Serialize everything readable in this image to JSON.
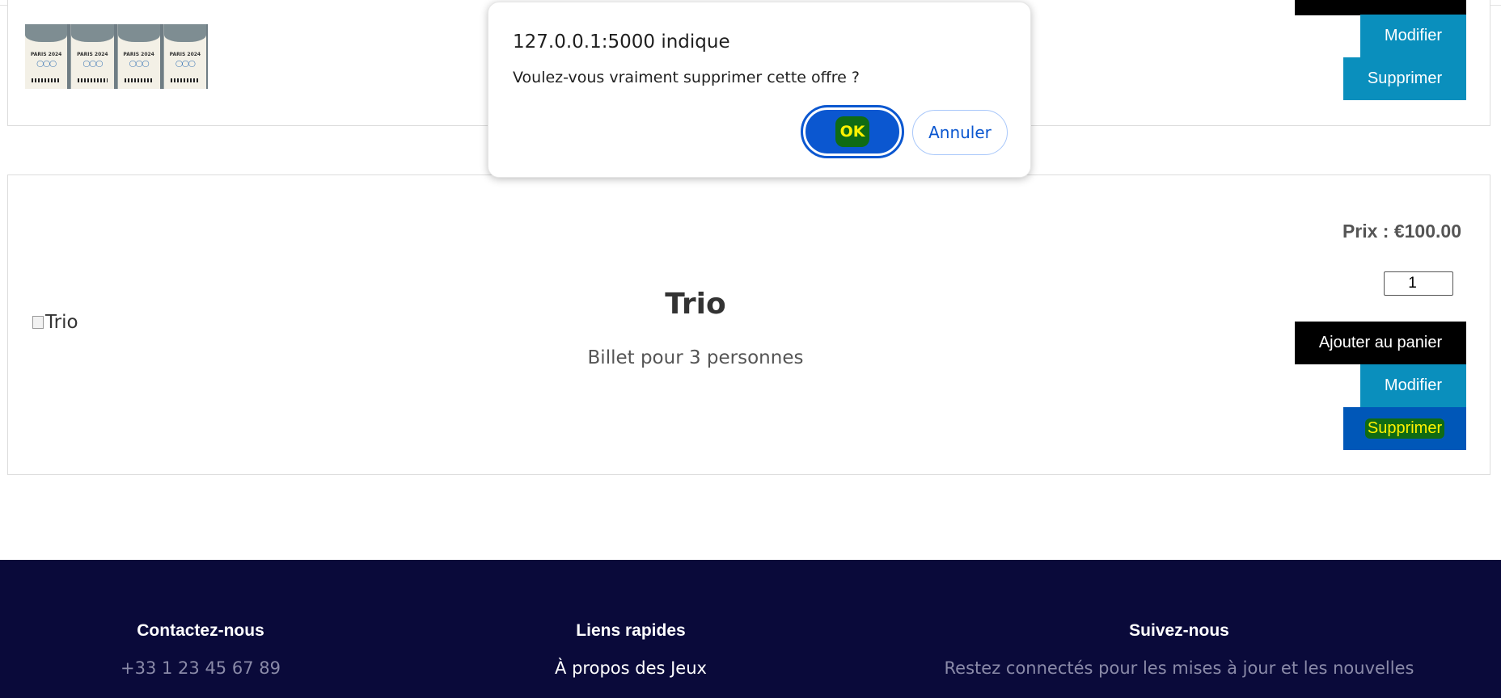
{
  "dialog": {
    "title": "127.0.0.1:5000 indique",
    "message": "Voulez-vous vraiment supprimer cette offre ?",
    "ok_label": "OK",
    "cancel_label": "Annuler"
  },
  "offers": [
    {
      "image_alt": "",
      "buttons": {
        "edit_label": "Modifier",
        "delete_label": "Supprimer"
      },
      "ticket_text": "PARIS 2024"
    },
    {
      "title": "Trio",
      "image_alt": "Trio",
      "description": "Billet pour 3 personnes",
      "price": "Prix : €100.00",
      "quantity": "1",
      "buttons": {
        "add_label": "Ajouter au panier",
        "edit_label": "Modifier",
        "delete_label": "Supprimer"
      }
    }
  ],
  "footer": {
    "contact": {
      "heading": "Contactez-nous",
      "phone": "+33 1 23 45 67 89"
    },
    "links": {
      "heading": "Liens rapides",
      "item": "À propos des Jeux"
    },
    "social": {
      "heading": "Suivez-nous",
      "text": "Restez connectés pour les mises à jour et les nouvelles"
    }
  },
  "colors": {
    "footer_bg": "#0a0a3a",
    "teal_button": "#0a8fbd",
    "active_button": "#0057b8",
    "dialog_primary": "#0b57d0"
  }
}
